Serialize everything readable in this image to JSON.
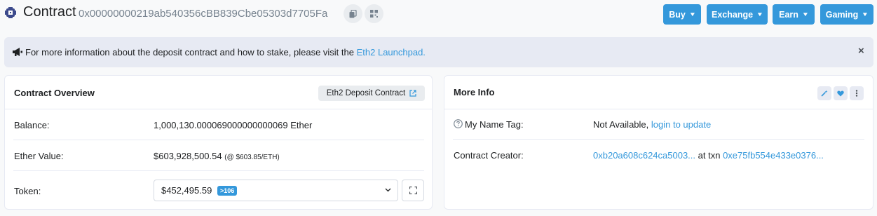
{
  "header": {
    "title": "Contract",
    "address": "0x00000000219ab540356cBB839Cbe05303d7705Fa",
    "nav": {
      "buy": "Buy",
      "exchange": "Exchange",
      "earn": "Earn",
      "gaming": "Gaming"
    }
  },
  "alert": {
    "text": "For more information about the deposit contract and how to stake, please visit the",
    "link": "Eth2 Launchpad.",
    "close": "×"
  },
  "overview": {
    "title": "Contract Overview",
    "badge": "Eth2 Deposit Contract",
    "rows": {
      "balance_label": "Balance:",
      "balance_value": "1,000,130.000069000000000069 Ether",
      "ether_value_label": "Ether Value:",
      "ether_value": "$603,928,500.54",
      "ether_rate": "(@ $603.85/ETH)",
      "token_label": "Token:",
      "token_value": "$452,495.59",
      "token_count": ">106"
    }
  },
  "more_info": {
    "title": "More Info",
    "name_tag_label": "My Name Tag:",
    "name_tag_value": "Not Available,",
    "name_tag_link": "login to update",
    "creator_label": "Contract Creator:",
    "creator_address": "0xb20a608c624ca5003...",
    "creator_at": "at txn",
    "creator_txn": "0xe75fb554e433e0376..."
  },
  "colors": {
    "accent": "#3498db",
    "alert_bg": "#e7eaf3",
    "page_bg": "#f8f9fa"
  },
  "icons": [
    "contract-logo-icon",
    "copy-icon",
    "qr-code-icon",
    "megaphone-icon",
    "close-icon",
    "external-link-icon",
    "wand-icon",
    "heart-icon",
    "more-vertical-icon",
    "question-circle-icon",
    "chevron-down-icon",
    "expand-icon"
  ]
}
